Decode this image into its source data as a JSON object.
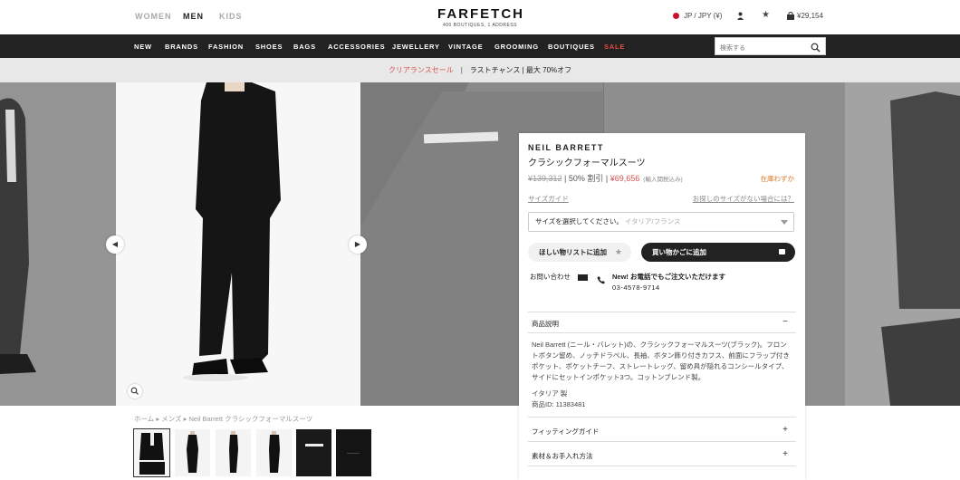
{
  "header": {
    "genders": [
      "WOMEN",
      "MEN",
      "KIDS"
    ],
    "logo_main": "FARFETCH",
    "logo_sub": "400 BOUTIQUES, 1 ADDRESS",
    "locale": "JP / JPY (¥)",
    "cart_total": "¥29,154"
  },
  "nav": {
    "items": [
      "NEW",
      "BRANDS",
      "FASHION",
      "SHOES",
      "BAGS",
      "ACCESSORIES",
      "JEWELLERY",
      "VINTAGE",
      "GROOMING",
      "BOUTIQUES",
      "SALE"
    ],
    "search_placeholder": "検索する"
  },
  "promo": {
    "left": "クリアランスセール",
    "sep": "|",
    "right": "ラストチャンス | 最大 70%オフ"
  },
  "breadcrumb": "ホーム ▸ メンズ ▸ Neil Barrett クラシックフォーマルスーツ",
  "product": {
    "brand": "NEIL BARRETT",
    "name": "クラシックフォーマルスーツ",
    "old_price": "¥139,312",
    "discount": " | 50% 割引 | ",
    "new_price": "¥69,656",
    "tax_note": "(輸入関税込み)",
    "stock": "在庫わずか",
    "size_guide": "サイズガイド",
    "size_help": "お探しのサイズがない場合には？",
    "size_select": "サイズを選択してください。",
    "size_hint": "イタリア/フランス",
    "wishlist_btn": "ほしい物リストに追加",
    "cart_btn": "買い物かごに追加",
    "contact_label": "お問い合わせ",
    "call_note": "New! お電話でもご注文いただけます",
    "phone": "03-4578-9714",
    "section_desc": "商品説明",
    "desc_sign": "−",
    "description": "Neil Barrett (ニール・バレット)の、クラシックフォーマルスーツ(ブラック)。フロントボタン留め、ノッチドラペル、長袖、ボタン飾り付きカフス、前面にフラップ付きポケット、ポケットチーフ、ストレートレッグ、留め具が隠れるコンシールタイプ、サイドにセットインポケット3つ。コットンブレンド製。",
    "made_in": "イタリア 製",
    "item_id": "商品ID: 11383481",
    "section_fit": "フィッティングガイド",
    "section_care": "素材＆お手入れ方法",
    "plus": "+"
  },
  "colors": {
    "nav_bg": "#222222",
    "sale": "#e74c3c",
    "promo_bg": "#e8e8e8",
    "price_red": "#d9534f",
    "stock_orange": "#d97a2b"
  }
}
